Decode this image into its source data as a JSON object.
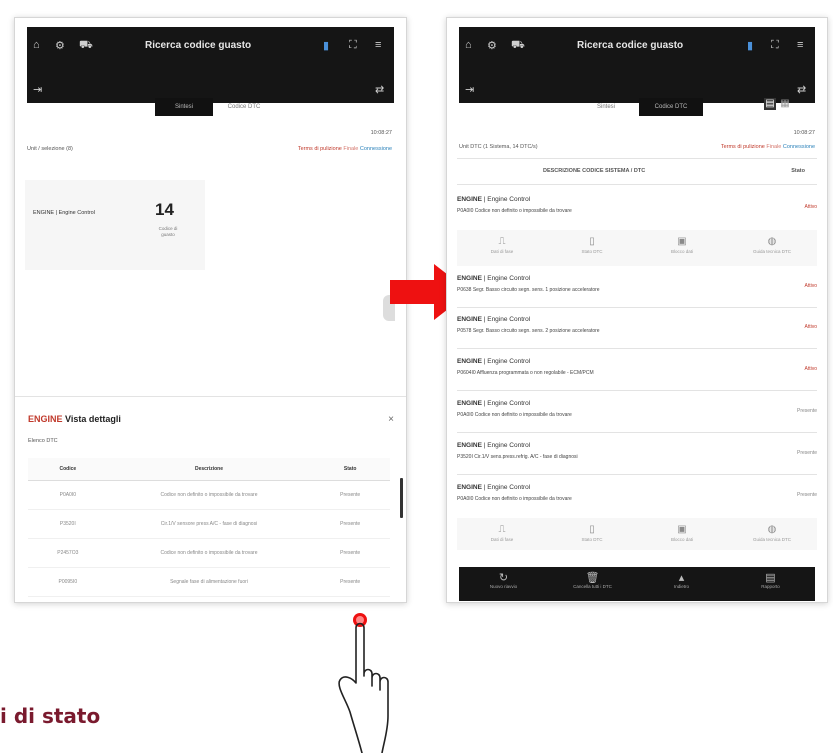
{
  "app": {
    "title": "Ricerca codice guasto",
    "time": "10:08:27",
    "status_links": {
      "terms": "Terms di pulizione",
      "finale": "Finale",
      "connect": "Connessione"
    }
  },
  "left": {
    "tabs": [
      "Sintesi",
      "Codice DTC"
    ],
    "unit_label": "Unit / selezione (8)",
    "card": {
      "label": "ENGINE | Engine Control",
      "count": "14",
      "caption": "Codice di guasto"
    },
    "details": {
      "prefix": "ENGINE",
      "title": "Vista dettagli",
      "list_label": "Elenco DTC",
      "columns": [
        "Codice",
        "Descrizione",
        "Stato"
      ],
      "rows": [
        {
          "code": "P0A0I0",
          "desc": "Codice non definito o impossibile da trovare",
          "status": "Presente"
        },
        {
          "code": "P3520I",
          "desc": "Cir.1/V sensore press A/C - fase di diagnosi",
          "status": "Presente"
        },
        {
          "code": "P2457O3",
          "desc": "Codice non definito o impossibile da trovare",
          "status": "Presente"
        },
        {
          "code": "P0095I0",
          "desc": "Segnale fase di alimentazione fuori",
          "status": "Presente"
        }
      ]
    }
  },
  "right": {
    "tabs": [
      "Sintesi",
      "Codice DTC"
    ],
    "unit_label": "Unit DTC (1 Sistema, 14 DTC/s)",
    "table_header": {
      "desc": "DESCRIZIONE CODICE SISTEMA / DTC",
      "status": "Stato"
    },
    "faults": [
      {
        "sys": "ENGINE",
        "sub": "Engine Control",
        "desc": "P0A0I0 Codice non definito o impossibile da trovare",
        "status": "Attivo",
        "color": "red"
      },
      {
        "sys": "ENGINE",
        "sub": "Engine Control",
        "desc": "P0638 Segr. Basso circuito segn. sens. 1 posizione acceleratore",
        "status": "Attivo",
        "color": "red"
      },
      {
        "sys": "ENGINE",
        "sub": "Engine Control",
        "desc": "P0578 Segr. Basso circuito segn. sens. 2 posizione acceleratore",
        "status": "Attivo",
        "color": "red"
      },
      {
        "sys": "ENGINE",
        "sub": "Engine Control",
        "desc": "P0604I0 Affluenza programmata o non regolabile - ECM/PCM",
        "status": "Attivo",
        "color": "red"
      },
      {
        "sys": "ENGINE",
        "sub": "Engine Control",
        "desc": "P0A0I0 Codice non definito o impossibile da trovare",
        "status": "Presente",
        "color": "grey"
      },
      {
        "sys": "ENGINE",
        "sub": "Engine Control",
        "desc": "P3520I Cir.1/V sens.press.refrig. A/C - fase di diagnosi",
        "status": "Presente",
        "color": "grey"
      },
      {
        "sys": "ENGINE",
        "sub": "Engine Control",
        "desc": "P0A0I0 Codice non definito o impossibile da trovare",
        "status": "Presente",
        "color": "grey"
      }
    ],
    "actions": [
      "Dati di fase",
      "Stato DTC",
      "Blocco dati",
      "Guida tecnica DTC"
    ],
    "bottom_nav": [
      "Nuovo riavvio",
      "Cancella tutti i DTC",
      "Indietro",
      "Rapporto"
    ]
  },
  "caption": "i di stato"
}
